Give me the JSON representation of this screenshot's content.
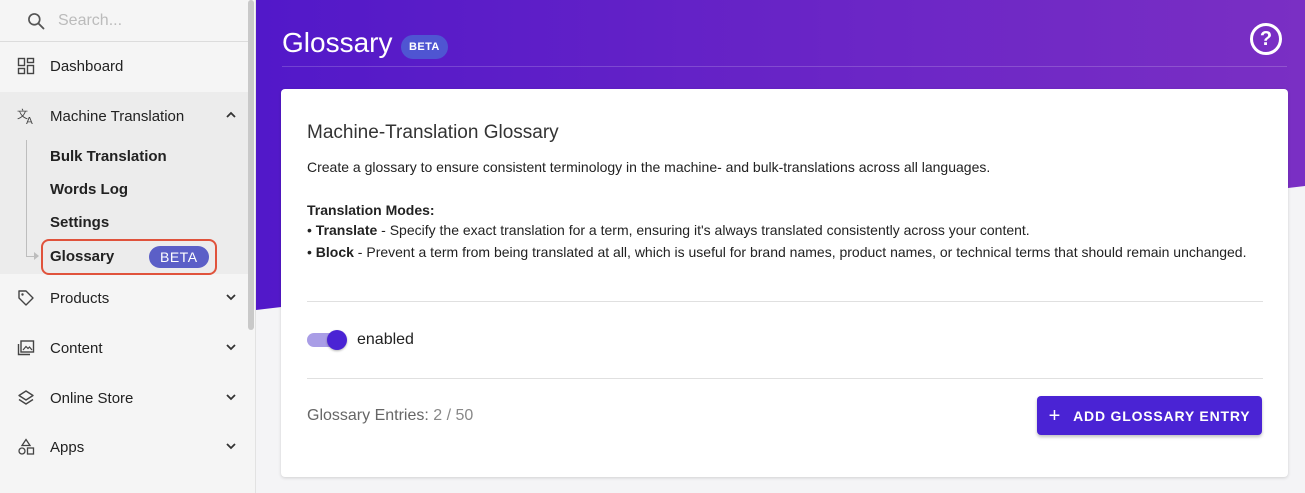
{
  "search": {
    "placeholder": "Search..."
  },
  "sidebar": {
    "items": [
      {
        "label": "Dashboard",
        "icon": "dashboard-icon"
      },
      {
        "label": "Machine Translation",
        "icon": "translate-icon",
        "expanded": true
      },
      {
        "label": "Products",
        "icon": "tag-icon"
      },
      {
        "label": "Content",
        "icon": "image-gallery-icon"
      },
      {
        "label": "Online Store",
        "icon": "layers-icon"
      },
      {
        "label": "Apps",
        "icon": "shapes-icon"
      }
    ],
    "submenu": [
      "Bulk Translation",
      "Words Log",
      "Settings"
    ],
    "active": {
      "label": "Glossary",
      "badge": "BETA"
    }
  },
  "header": {
    "title": "Glossary",
    "badge": "BETA"
  },
  "card": {
    "title": "Machine-Translation Glossary",
    "description": "Create a glossary to ensure consistent terminology in the machine- and bulk-translations across all languages.",
    "modes_heading": "Translation Modes:",
    "modes": [
      {
        "bullet": "• ",
        "name": "Translate",
        "text": " - Specify the exact translation for a term, ensuring it's always translated consistently across your content."
      },
      {
        "bullet": "• ",
        "name": "Block",
        "text": " - Prevent a term from being translated at all, which is useful for brand names, product names, or technical terms that should remain unchanged."
      }
    ],
    "toggle": {
      "label": "enabled",
      "on": true
    },
    "entries": {
      "label": "Glossary Entries:",
      "count": "2 / 50"
    },
    "add_button": {
      "icon": "plus",
      "label": "ADD GLOSSARY ENTRY"
    }
  },
  "colors": {
    "primary": "#4a23d4",
    "header_gradient_start": "#5218c9",
    "header_gradient_end": "#7a2fc4",
    "highlight": "#e0533c",
    "badge": "#5b5fc7"
  }
}
